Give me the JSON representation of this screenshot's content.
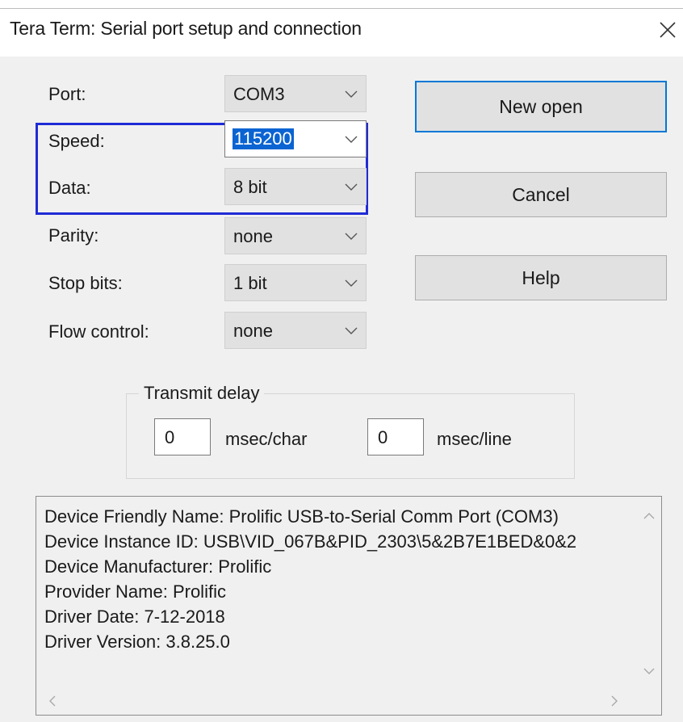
{
  "window": {
    "title": "Tera Term: Serial port setup and connection",
    "close_icon": "close-icon"
  },
  "fields": [
    {
      "label": "Port:",
      "value": "COM3"
    },
    {
      "label": "Speed:",
      "value": "115200"
    },
    {
      "label": "Data:",
      "value": "8 bit"
    },
    {
      "label": "Parity:",
      "value": "none"
    },
    {
      "label": "Stop bits:",
      "value": "1 bit"
    },
    {
      "label": "Flow control:",
      "value": "none"
    }
  ],
  "buttons": {
    "new_open": "New open",
    "cancel": "Cancel",
    "help": "Help"
  },
  "transmit_delay": {
    "title": "Transmit delay",
    "char_value": "0",
    "char_unit": "msec/char",
    "line_value": "0",
    "line_unit": "msec/line"
  },
  "device_info": [
    "Device Friendly Name: Prolific USB-to-Serial Comm Port (COM3)",
    "Device Instance ID: USB\\VID_067B&PID_2303\\5&2B7E1BED&0&2",
    "Device Manufacturer: Prolific",
    "Provider Name: Prolific",
    "Driver Date: 7-12-2018",
    "Driver Version: 3.8.25.0"
  ],
  "colors": {
    "highlight": "#1f2bd6",
    "default_button_border": "#0078d7",
    "selection": "#0a64d2"
  }
}
